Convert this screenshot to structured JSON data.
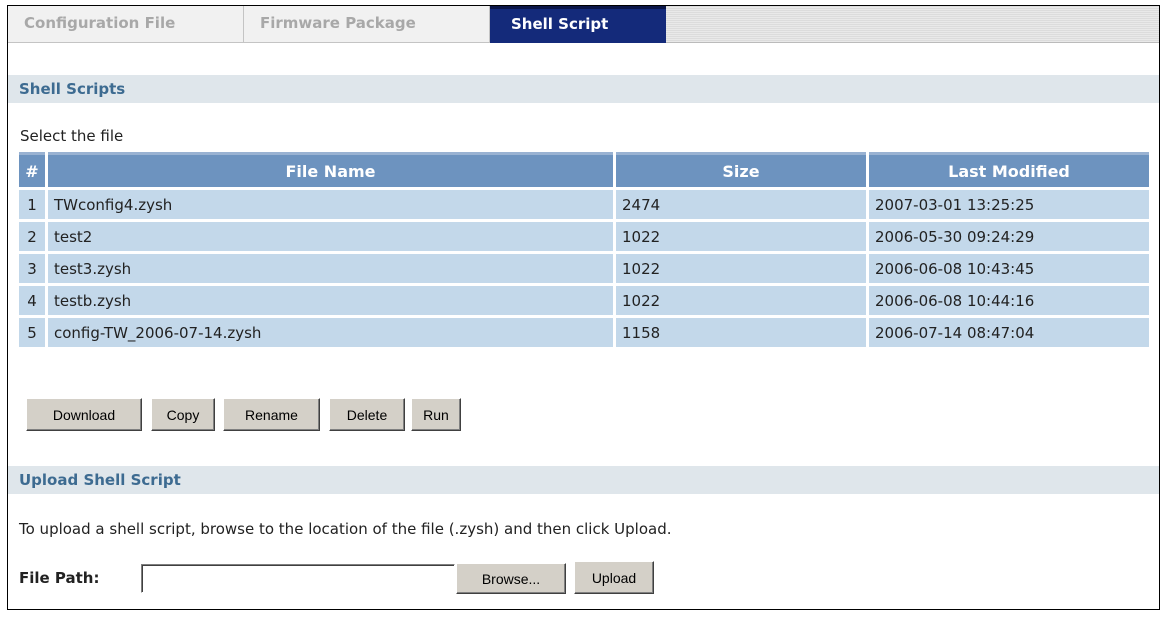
{
  "tabs": [
    {
      "label": "Configuration File",
      "active": false
    },
    {
      "label": "Firmware Package",
      "active": false
    },
    {
      "label": "Shell Script",
      "active": true
    }
  ],
  "shell_scripts": {
    "section_title": "Shell Scripts",
    "select_label": "Select the file",
    "columns": [
      "#",
      "File Name",
      "Size",
      "Last Modified"
    ],
    "rows": [
      {
        "num": "1",
        "name": "TWconfig4.zysh",
        "size": "2474",
        "modified": "2007-03-01 13:25:25"
      },
      {
        "num": "2",
        "name": "test2",
        "size": "1022",
        "modified": "2006-05-30 09:24:29"
      },
      {
        "num": "3",
        "name": "test3.zysh",
        "size": "1022",
        "modified": "2006-06-08 10:43:45"
      },
      {
        "num": "4",
        "name": "testb.zysh",
        "size": "1022",
        "modified": "2006-06-08 10:44:16"
      },
      {
        "num": "5",
        "name": "config-TW_2006-07-14.zysh",
        "size": "1158",
        "modified": "2006-07-14 08:47:04"
      }
    ],
    "buttons": {
      "download": "Download",
      "copy": "Copy",
      "rename": "Rename",
      "delete": "Delete",
      "run": "Run"
    }
  },
  "upload": {
    "section_title": "Upload Shell Script",
    "instructions": "To upload a shell script, browse to the location of the file (.zysh) and then click Upload.",
    "file_path_label": "File Path:",
    "file_path_value": "",
    "browse_label": "Browse...",
    "upload_label": "Upload"
  },
  "colors": {
    "active_tab": "#142a7a",
    "section_band": "#dfe6eb",
    "section_text": "#3d6b91",
    "table_header": "#6d93bf",
    "table_row": "#c3d8ea"
  }
}
